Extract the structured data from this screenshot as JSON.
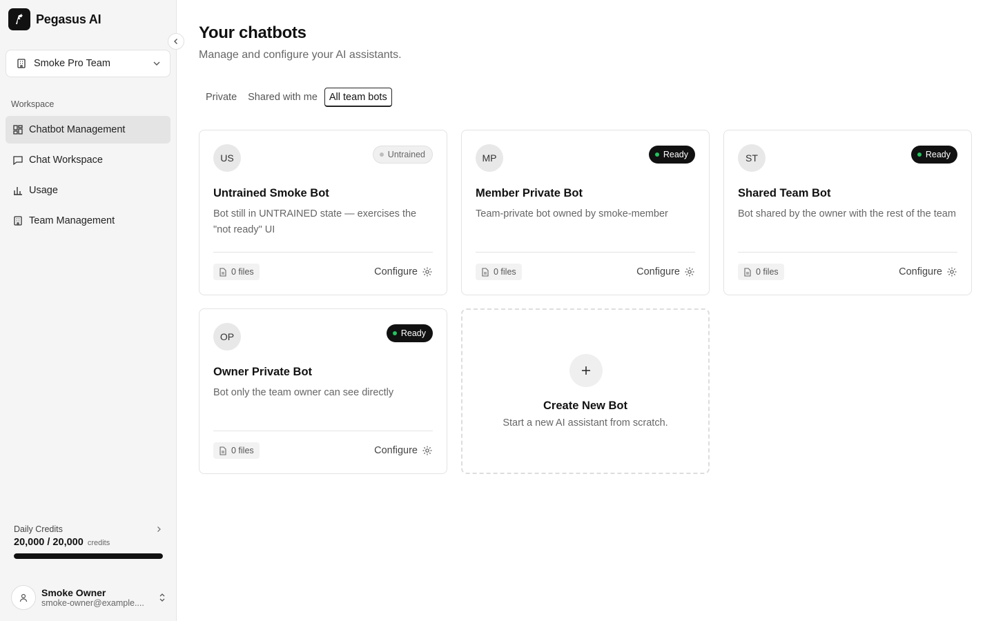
{
  "brand": {
    "name": "Pegasus AI"
  },
  "team_selector": {
    "label": "Smoke Pro Team"
  },
  "sidebar": {
    "section_label": "Workspace",
    "items": [
      {
        "label": "Chatbot Management",
        "icon": "layout-grid-icon",
        "active": true
      },
      {
        "label": "Chat Workspace",
        "icon": "message-square-icon",
        "active": false
      },
      {
        "label": "Usage",
        "icon": "bar-chart-icon",
        "active": false
      },
      {
        "label": "Team Management",
        "icon": "building-icon",
        "active": false
      }
    ]
  },
  "credits": {
    "label": "Daily Credits",
    "value": "20,000 / 20,000",
    "unit": "credits",
    "progress_fraction": 1.0
  },
  "user": {
    "name": "Smoke Owner",
    "email": "smoke-owner@example...."
  },
  "main": {
    "title": "Your chatbots",
    "subtitle": "Manage and configure your AI assistants.",
    "tabs": [
      {
        "label": "Private",
        "active": false
      },
      {
        "label": "Shared with me",
        "active": false
      },
      {
        "label": "All team bots",
        "active": true
      }
    ],
    "bots": [
      {
        "initials": "US",
        "status": "Untrained",
        "status_kind": "untrained",
        "name": "Untrained Smoke Bot",
        "description": "Bot still in UNTRAINED state — exercises the \"not ready\" UI",
        "files": "0 files",
        "configure": "Configure"
      },
      {
        "initials": "MP",
        "status": "Ready",
        "status_kind": "ready",
        "name": "Member Private Bot",
        "description": "Team-private bot owned by smoke-member",
        "files": "0 files",
        "configure": "Configure"
      },
      {
        "initials": "ST",
        "status": "Ready",
        "status_kind": "ready",
        "name": "Shared Team Bot",
        "description": "Bot shared by the owner with the rest of the team",
        "files": "0 files",
        "configure": "Configure"
      },
      {
        "initials": "OP",
        "status": "Ready",
        "status_kind": "ready",
        "name": "Owner Private Bot",
        "description": "Bot only the team owner can see directly",
        "files": "0 files",
        "configure": "Configure"
      }
    ],
    "create": {
      "title": "Create New Bot",
      "subtitle": "Start a new AI assistant from scratch."
    }
  },
  "colors": {
    "ready_dot": "#22c55e",
    "untrained_dot": "#bdbdbd",
    "accent": "#111111"
  }
}
